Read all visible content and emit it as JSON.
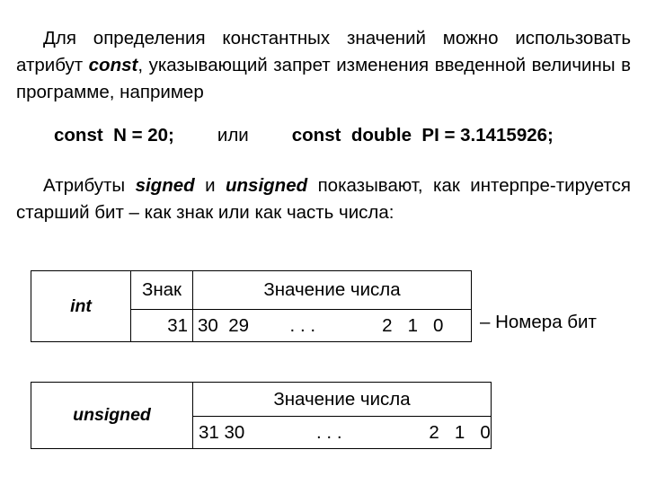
{
  "slide": {
    "language": "ru",
    "background_color": "#ffffff",
    "text_color": "#000000"
  },
  "paragraphs": {
    "const_paragraph": {
      "part1": "Для определения константных значений можно использовать атрибут ",
      "keyword": "const",
      "part2": ", указывающий запрет изменения введенной величины в программе, например"
    },
    "signed_paragraph": {
      "part1": "Атрибуты ",
      "keyword1": "signed",
      "part2": " и ",
      "keyword2": "unsigned",
      "part3": " показывают, как интерпре-тируется старший  бит – как  знак  или  как часть числа:"
    }
  },
  "code_line": {
    "example1": "const  N = 20;",
    "conjunction": "или",
    "example2": "const  double  PI = 3.1415926;"
  },
  "tables": {
    "int_table": {
      "type_label": "int",
      "headers": [
        "Знак",
        "Значение числа"
      ],
      "sign_bit": "31",
      "value_bits": "30  29        . . .             2   1   0"
    },
    "unsigned_table": {
      "type_label": "unsigned",
      "header": "Значение числа",
      "value_bits": "31 30              . . .                 2   1   0"
    }
  },
  "caption": {
    "bit_numbers": "– Номера бит"
  }
}
